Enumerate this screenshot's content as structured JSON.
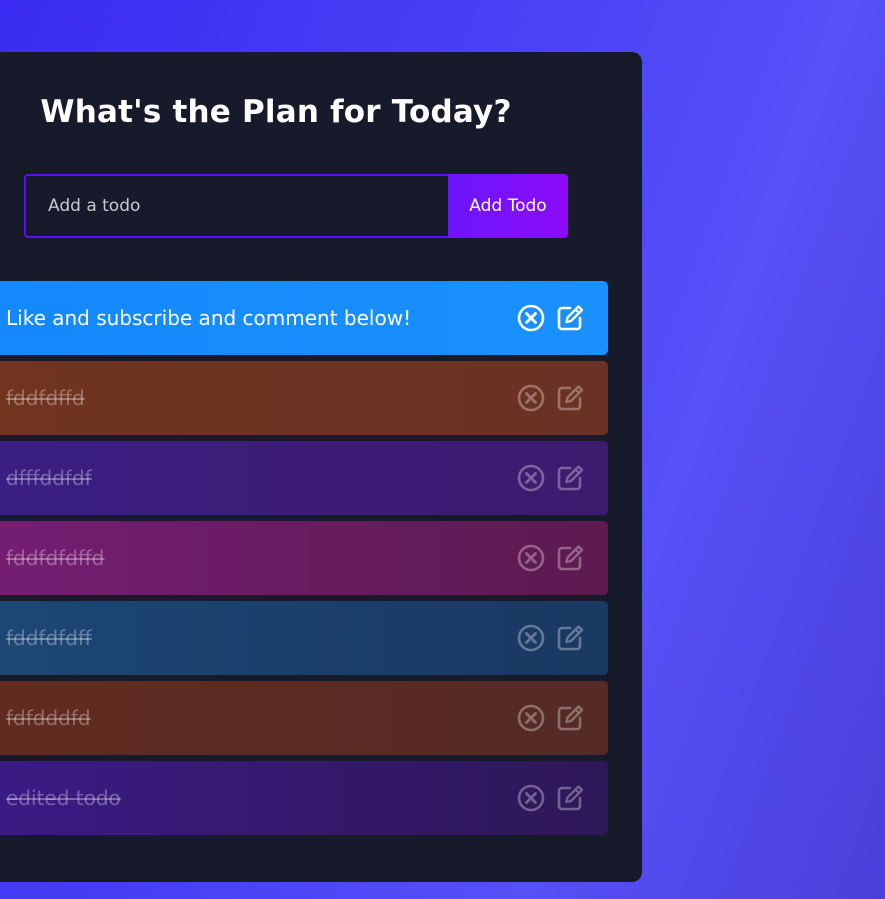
{
  "app": {
    "title": "What's the Plan for Today?"
  },
  "form": {
    "input_placeholder": "Add a todo",
    "input_value": "",
    "add_button_label": "Add Todo"
  },
  "todos": [
    {
      "text": "Like and subscribe and comment below!",
      "complete": false,
      "color_start": "#1488fc",
      "color_end": "#1a91ff"
    },
    {
      "text": "fddfdffd",
      "complete": true,
      "color_start": "#70341f",
      "color_end": "#6a3224"
    },
    {
      "text": "dfffddfdf",
      "complete": true,
      "color_start": "#3a1e82",
      "color_end": "#3d1b6e"
    },
    {
      "text": "fddfdfdffd",
      "complete": true,
      "color_start": "#751e74",
      "color_end": "#5c1a4f"
    },
    {
      "text": "fddfdfdff",
      "complete": true,
      "color_start": "#1d4775",
      "color_end": "#193862"
    },
    {
      "text": "fdfdddfd",
      "complete": true,
      "color_start": "#622b20",
      "color_end": "#552a26"
    },
    {
      "text": "edited todo",
      "complete": true,
      "color_start": "#3b1b86",
      "color_end": "#2e1756"
    }
  ],
  "icons": {
    "delete": "close-circle-icon",
    "edit": "edit-icon"
  }
}
